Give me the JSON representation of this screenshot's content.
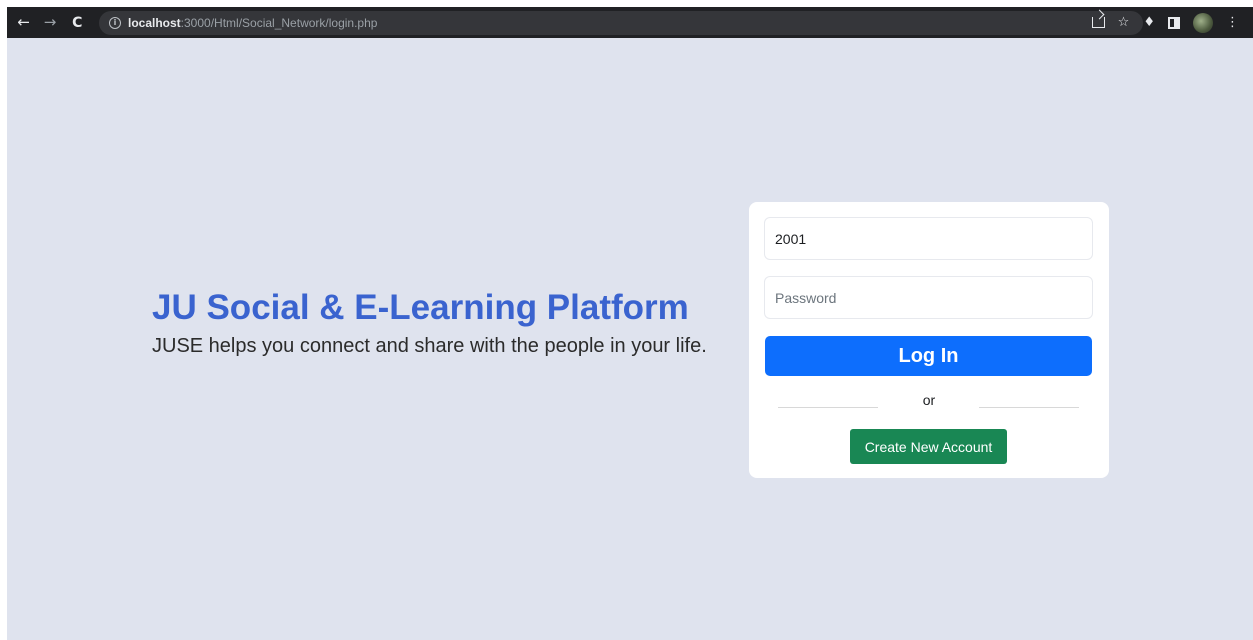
{
  "browser": {
    "url_host": "localhost",
    "url_path": ":3000/Html/Social_Network/login.php",
    "icons": [
      "back-arrow-icon",
      "forward-arrow-icon",
      "reload-icon",
      "info-icon",
      "share-icon",
      "star-icon",
      "extensions-icon",
      "side-panel-icon",
      "profile-avatar",
      "menu-icon"
    ]
  },
  "brand": {
    "title": "JU Social & E-Learning Platform",
    "subtitle": "JUSE helps you connect and share with the people in your life."
  },
  "login": {
    "email_value": "2001",
    "password_placeholder": "Password",
    "login_label": "Log In",
    "divider_text": "or",
    "create_label": "Create New Account"
  },
  "colors": {
    "page_background": "#dfe3ee",
    "brand_title": "#3a63cf",
    "login_button": "#0d6efd",
    "create_button": "#198754",
    "browser_chrome": "#202124"
  }
}
